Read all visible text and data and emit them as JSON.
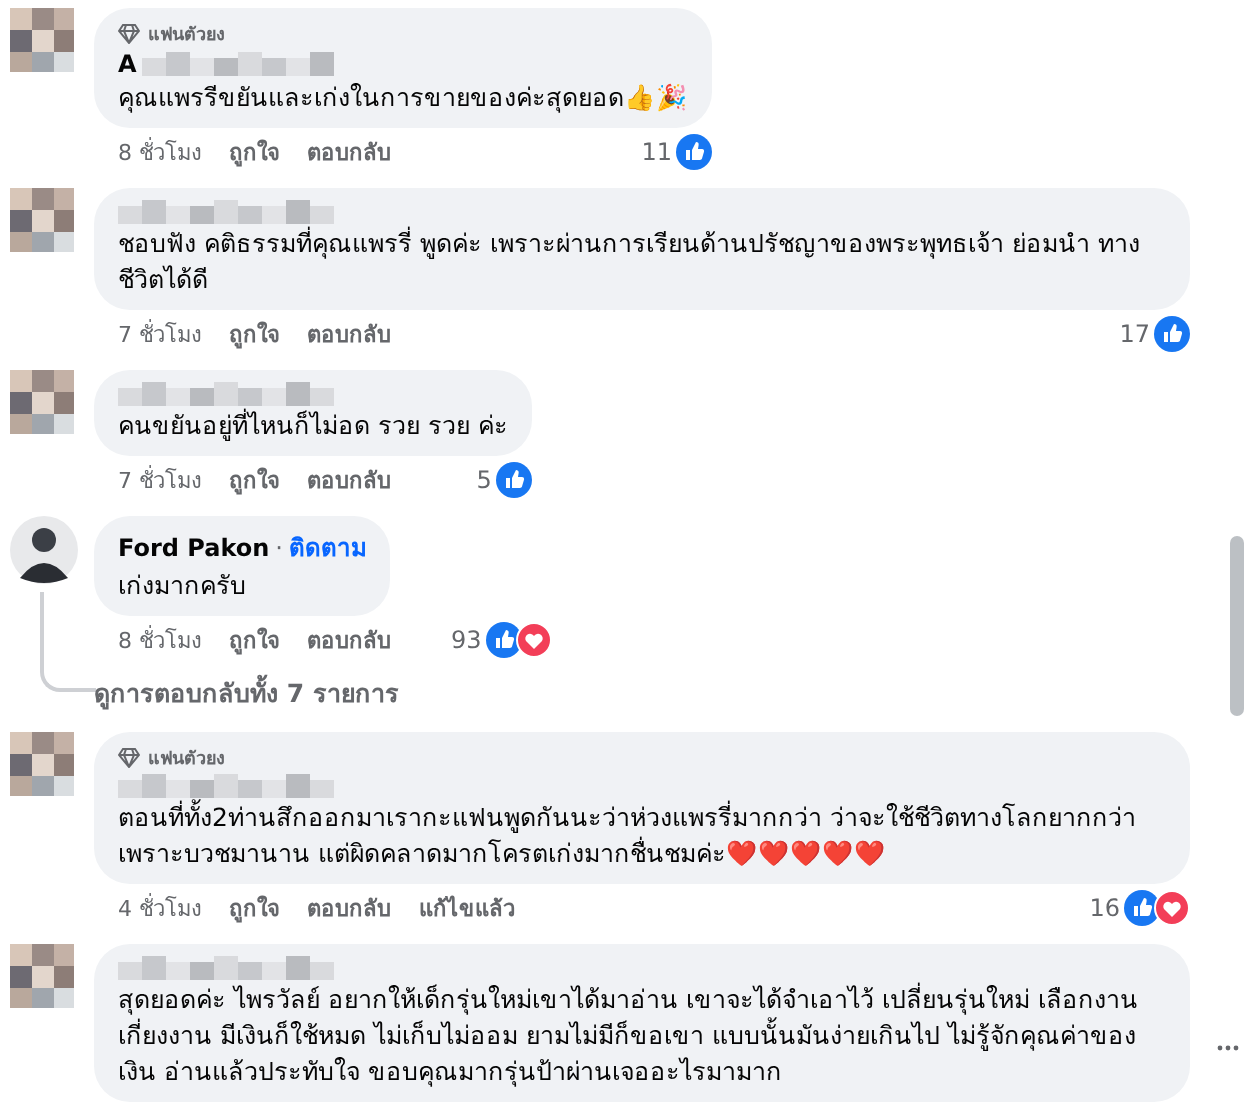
{
  "comments": [
    {
      "avatar": {
        "kind": "blurred"
      },
      "badge": "แฟนตัวยง",
      "name": "A",
      "name_blurred": true,
      "text": "คุณแพรรีขยันและเก่งในการขายของค่ะสุดยอด👍🎉",
      "time": "8 ชั่วโมง",
      "like_label": "ถูกใจ",
      "reply_label": "ตอบกลับ",
      "reaction_count": "11",
      "reactions": [
        {
          "kind": "like"
        }
      ],
      "wide": false
    },
    {
      "avatar": {
        "kind": "blurred"
      },
      "name_blurred": true,
      "text": "ชอบฟัง คติธรรมที่คุณแพรรี่ พูดค่ะ เพราะผ่านการเรียนด้านปรัชญาของพระพุทธเจ้า ย่อมนำ ทาง ชีวิตได้ดี",
      "time": "7 ชั่วโมง",
      "like_label": "ถูกใจ",
      "reply_label": "ตอบกลับ",
      "reaction_count": "17",
      "reactions": [
        {
          "kind": "like"
        }
      ],
      "wide": true
    },
    {
      "avatar": {
        "kind": "blurred"
      },
      "name_blurred": true,
      "text": "คนขยันอยู่ที่ไหนก็ไม่อด รวย รวย ค่ะ",
      "time": "7 ชั่วโมง",
      "like_label": "ถูกใจ",
      "reply_label": "ตอบกลับ",
      "reaction_count": "5",
      "reactions": [
        {
          "kind": "like"
        }
      ],
      "wide": false
    },
    {
      "avatar": {
        "kind": "person"
      },
      "name": "Ford Pakon",
      "name_blurred": false,
      "separator": "·",
      "follow": "ติดตาม",
      "text": "เก่งมากครับ",
      "time": "8 ชั่วโมง",
      "like_label": "ถูกใจ",
      "reply_label": "ตอบกลับ",
      "reaction_count": "93",
      "reactions": [
        {
          "kind": "like"
        },
        {
          "kind": "love"
        }
      ],
      "wide": false,
      "view_replies": "ดูการตอบกลับทั้ง 7 รายการ"
    },
    {
      "avatar": {
        "kind": "blurred"
      },
      "badge": "แฟนตัวยง",
      "name_blurred": true,
      "text": "ตอนที่ทั้ง2ท่านสึกออกมาเรากะแฟนพูดกันนะว่าห่วงแพรรี่มากกว่า ว่าจะใช้ชีวิตทางโลกยากกว่า เพราะบวชมานาน แต่ผิดคลาดมากโครตเก่งมากชื่นชมค่ะ❤️❤️❤️❤️❤️",
      "time": "4 ชั่วโมง",
      "like_label": "ถูกใจ",
      "reply_label": "ตอบกลับ",
      "edited_label": "แก้ไขแล้ว",
      "reaction_count": "16",
      "reactions": [
        {
          "kind": "like"
        },
        {
          "kind": "love"
        }
      ],
      "wide": true
    },
    {
      "avatar": {
        "kind": "blurred"
      },
      "name_blurred": true,
      "text": "สุดยอดค่ะ ไพรวัลย์ อยากให้เด็กรุ่นใหม่เขาได้มาอ่าน เขาจะได้จำเอาไว้ เปลี่ยนรุ่นใหม่ เลือกงาน เกี่ยงงาน มีเงินก็ใช้หมด ไม่เก็บไม่ออม ยามไม่มีก็ขอเขา แบบนั้นมันง่ายเกินไป ไม่รู้จักคุณค่าของ เงิน อ่านแล้วประทับใจ ขอบคุณมากรุ่นป้าผ่านเจออะไรมามาก",
      "wide": true,
      "more": true
    }
  ]
}
